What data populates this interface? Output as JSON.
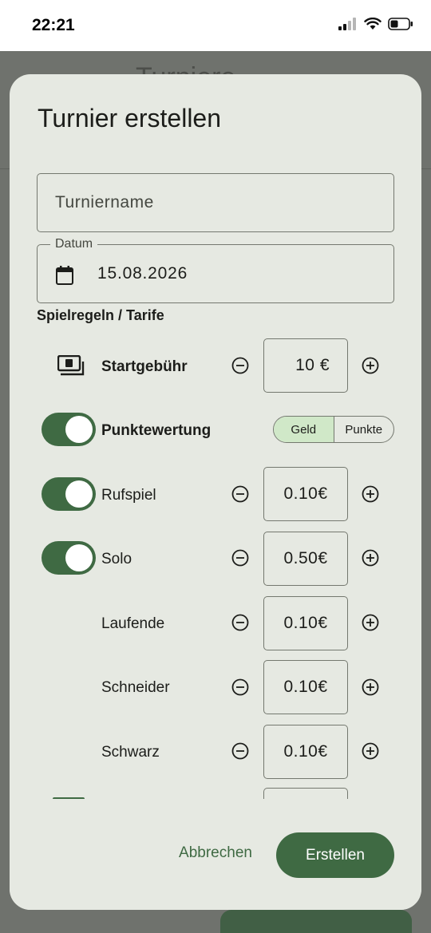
{
  "status_bar": {
    "time": "22:21",
    "icons": [
      "signal-icon",
      "wifi-icon",
      "battery-icon"
    ]
  },
  "background": {
    "title": "Turniere"
  },
  "dialog": {
    "title": "Turnier erstellen",
    "name_field": {
      "placeholder": "Turniername",
      "value": ""
    },
    "date_field": {
      "label": "Datum",
      "value": "15.08.2026",
      "icon": "calendar-icon"
    },
    "section_title": "Spielregeln / Tarife",
    "start_fee": {
      "label": "Startgebühr",
      "icon": "money-icon",
      "value": "10 €"
    },
    "scoring": {
      "label": "Punktewertung",
      "enabled": true,
      "options": [
        "Geld",
        "Punkte"
      ],
      "selected": "Geld"
    },
    "tariffs": [
      {
        "label": "Rufspiel",
        "value": "0.10€",
        "toggle": true
      },
      {
        "label": "Solo",
        "value": "0.50€",
        "toggle": true
      },
      {
        "label": "Laufende",
        "value": "0.10€",
        "toggle": false
      },
      {
        "label": "Schneider",
        "value": "0.10€",
        "toggle": false
      },
      {
        "label": "Schwarz",
        "value": "0.10€",
        "toggle": false
      }
    ],
    "actions": {
      "cancel": "Abbrechen",
      "create": "Erstellen"
    }
  },
  "colors": {
    "accent": "#3f6a43",
    "dialog_bg": "#e6e9e2",
    "scrim": "#6f726d",
    "segment_active": "#d0e8c8"
  }
}
